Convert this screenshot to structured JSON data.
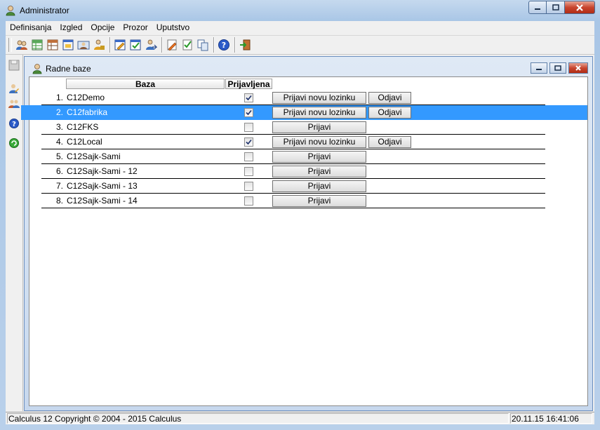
{
  "window": {
    "title": "Administrator"
  },
  "menu": [
    "Definisanja",
    "Izgled",
    "Opcije",
    "Prozor",
    "Uputstvo"
  ],
  "toolbar": {
    "icons": [
      "users-icon",
      "add-table-icon",
      "table-icon",
      "form-icon",
      "user-card-icon",
      "user-lock-icon",
      "edit-form-icon",
      "check-form-icon",
      "user-arrow-icon",
      "pencil-doc-icon",
      "doc-check-icon",
      "copy-doc-icon",
      "help-icon",
      "exit-icon"
    ]
  },
  "child_window": {
    "title": "Radne baze",
    "columns": {
      "baza": "Baza",
      "prijavljena": "Prijavljena"
    },
    "rows": [
      {
        "num": "1.",
        "name": "C12Demo",
        "checked": true,
        "selected": false,
        "primary": "Prijavi novu lozinku",
        "secondary": "Odjavi"
      },
      {
        "num": "2.",
        "name": "C12fabrika",
        "checked": true,
        "selected": true,
        "primary": "Prijavi novu lozinku",
        "secondary": "Odjavi"
      },
      {
        "num": "3.",
        "name": "C12FKS",
        "checked": false,
        "selected": false,
        "primary": "Prijavi",
        "secondary": ""
      },
      {
        "num": "4.",
        "name": "C12Local",
        "checked": true,
        "selected": false,
        "primary": "Prijavi novu lozinku",
        "secondary": "Odjavi"
      },
      {
        "num": "5.",
        "name": "C12Sajk-Sami",
        "checked": false,
        "selected": false,
        "primary": "Prijavi",
        "secondary": ""
      },
      {
        "num": "6.",
        "name": "C12Sajk-Sami - 12",
        "checked": false,
        "selected": false,
        "primary": "Prijavi",
        "secondary": ""
      },
      {
        "num": "7.",
        "name": "C12Sajk-Sami - 13",
        "checked": false,
        "selected": false,
        "primary": "Prijavi",
        "secondary": ""
      },
      {
        "num": "8.",
        "name": "C12Sajk-Sami - 14",
        "checked": false,
        "selected": false,
        "primary": "Prijavi",
        "secondary": ""
      }
    ]
  },
  "status": {
    "left": "Calculus 12  Copyright © 2004 - 2015  Calculus",
    "right": "20.11.15 16:41:06"
  },
  "colors": {
    "selection": "#3399ff",
    "mdi_background": "#ababab",
    "close_button": "#c8452f"
  }
}
